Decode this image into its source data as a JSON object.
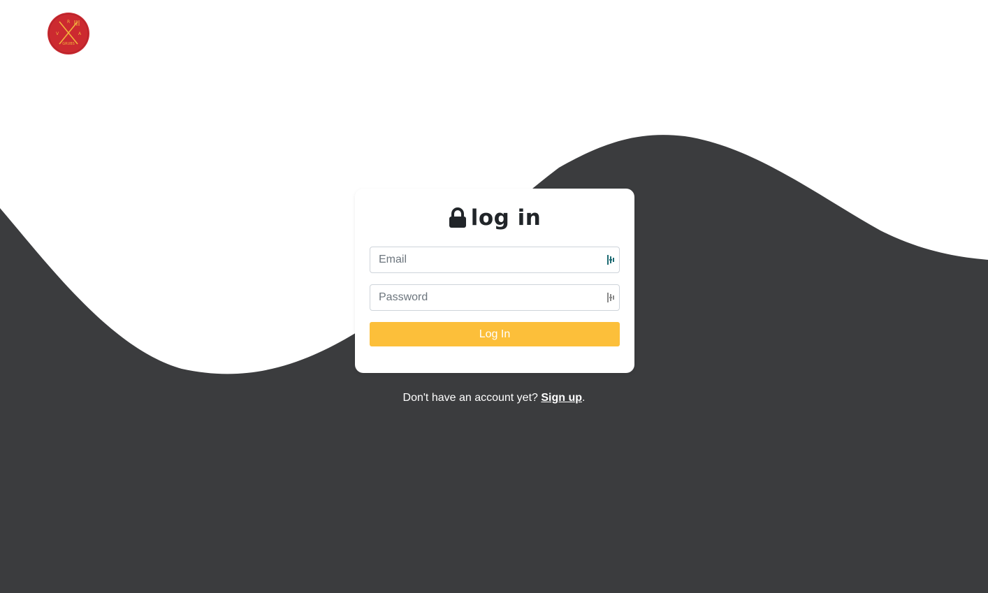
{
  "brand": {
    "logo_text": "GRUBS",
    "logo_letters": [
      "V",
      "R",
      "A"
    ],
    "logo_color": "#cc2a30",
    "logo_accent": "#f2b33d"
  },
  "background": {
    "wave_color": "#3b3c3e",
    "page_color": "#ffffff"
  },
  "login": {
    "title": "log in",
    "email_placeholder": "Email",
    "password_placeholder": "Password",
    "submit_label": "Log In",
    "button_color": "#fcbf3a"
  },
  "footer": {
    "prompt": "Don't have an account yet?",
    "signup_label": "Sign up",
    "suffix": "."
  },
  "icons": {
    "title_icon": "lock-icon",
    "email_field_icon": "password-manager-icon",
    "password_field_icon": "password-manager-icon"
  }
}
